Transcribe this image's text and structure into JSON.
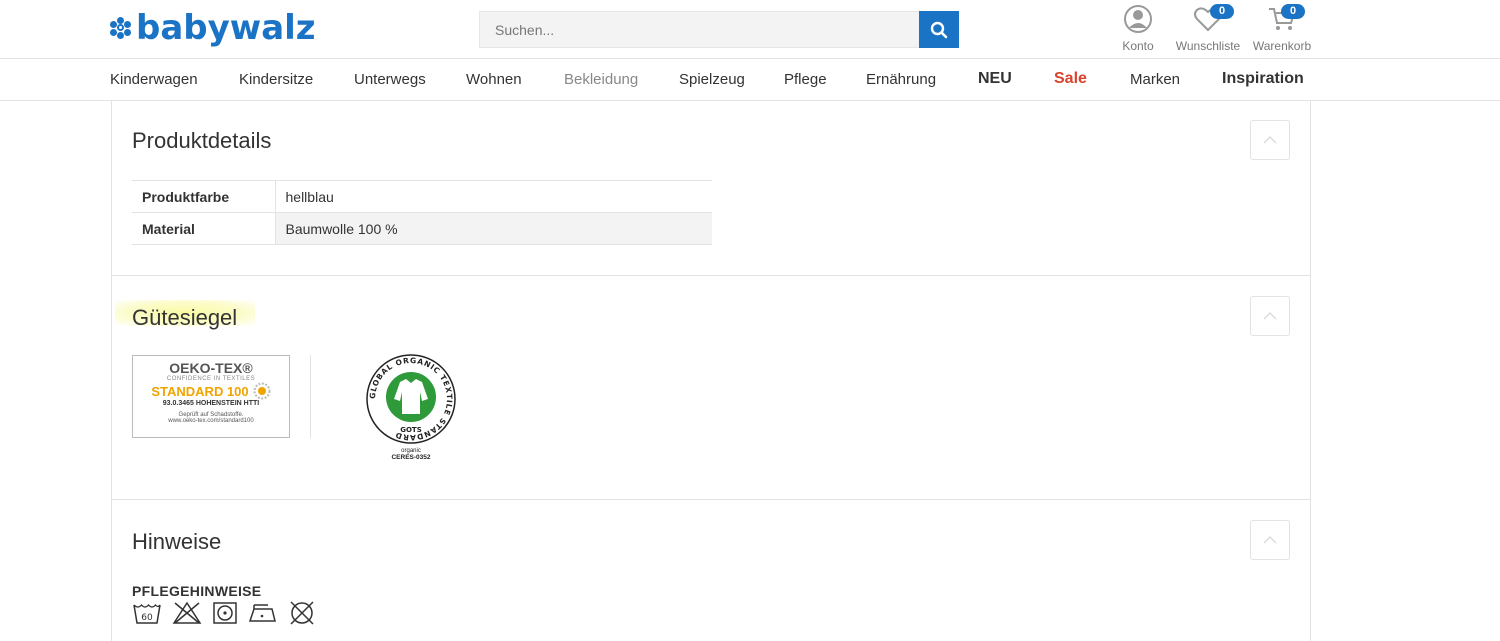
{
  "header": {
    "logo_text": "babywalz",
    "search_placeholder": "Suchen...",
    "account_label": "Konto",
    "wishlist_label": "Wunschliste",
    "wishlist_count": "0",
    "cart_label": "Warenkorb",
    "cart_count": "0"
  },
  "nav": {
    "items": [
      {
        "label": "Kinderwagen"
      },
      {
        "label": "Kindersitze"
      },
      {
        "label": "Unterwegs"
      },
      {
        "label": "Wohnen"
      },
      {
        "label": "Bekleidung"
      },
      {
        "label": "Spielzeug"
      },
      {
        "label": "Pflege"
      },
      {
        "label": "Ernährung"
      },
      {
        "label": "NEU"
      },
      {
        "label": "Sale"
      },
      {
        "label": "Marken"
      },
      {
        "label": "Inspiration"
      }
    ]
  },
  "details": {
    "title": "Produktdetails",
    "rows": [
      {
        "key": "Produktfarbe",
        "value": "hellblau"
      },
      {
        "key": "Material",
        "value": "Baumwolle 100 %"
      }
    ]
  },
  "seals": {
    "title": "Gütesiegel",
    "oeko": {
      "line1": "OEKO-TEX®",
      "line2": "CONFIDENCE IN TEXTILES",
      "line3": "STANDARD 100",
      "line4": "93.0.3465 HOHENSTEIN HTTI",
      "line5": "Geprüft auf Schadstoffe.",
      "line6": "www.oeko-tex.com/standard100"
    },
    "gots": {
      "ring_text": "GLOBAL ORGANIC TEXTILE STANDARD",
      "short": "GOTS",
      "line1": "organic",
      "line2": "CERES-0352"
    }
  },
  "notes": {
    "title": "Hinweise",
    "care_title": "PFLEGEHINWEISE",
    "wash_temp": "60",
    "care_icons": [
      "wash-60-icon",
      "no-bleach-icon",
      "tumble-dry-icon",
      "iron-icon",
      "no-dry-clean-icon"
    ]
  },
  "colors": {
    "brand": "#1a73c5",
    "sale": "#d9432f",
    "gots_green": "#2e9a3a",
    "oeko_orange": "#f0a400"
  }
}
